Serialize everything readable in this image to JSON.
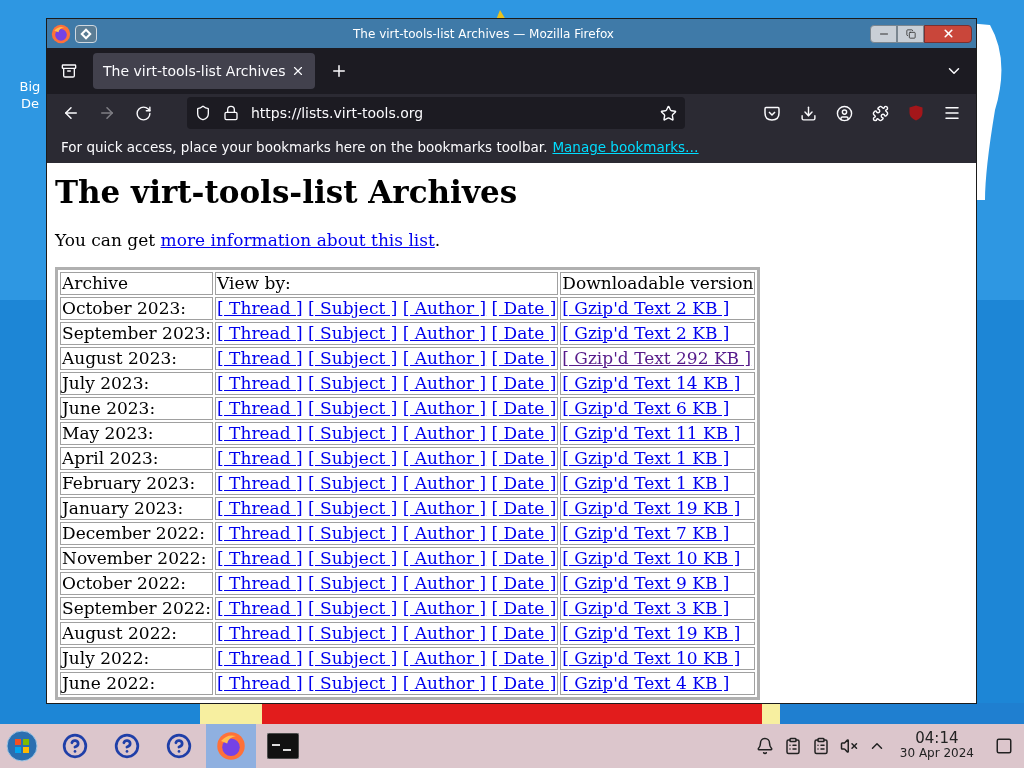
{
  "desktop": {
    "icon_label": [
      "Big",
      "De"
    ]
  },
  "window": {
    "title": "The virt-tools-list Archives — Mozilla Firefox"
  },
  "tabs": [
    {
      "label": "The virt-tools-list Archives",
      "selected": true
    }
  ],
  "url": "https://lists.virt-tools.org",
  "bookmarks_bar": {
    "message": "For quick access, place your bookmarks here on the bookmarks toolbar.",
    "link": "Manage bookmarks…"
  },
  "page": {
    "heading": "The virt-tools-list Archives",
    "intro_before": "You can get ",
    "intro_link": "more information about this list",
    "intro_after": "."
  },
  "table": {
    "columns": [
      "Archive",
      "View by:",
      "Downloadable version"
    ],
    "rows": [
      {
        "archive": "October 2023:",
        "views": [
          "[ Thread ]",
          "[ Subject ]",
          "[ Author ]",
          "[ Date ]"
        ],
        "download": "[ Gzip'd Text 2 KB ]",
        "visited": false
      },
      {
        "archive": "September 2023:",
        "views": [
          "[ Thread ]",
          "[ Subject ]",
          "[ Author ]",
          "[ Date ]"
        ],
        "download": "[ Gzip'd Text 2 KB ]",
        "visited": false
      },
      {
        "archive": "August 2023:",
        "views": [
          "[ Thread ]",
          "[ Subject ]",
          "[ Author ]",
          "[ Date ]"
        ],
        "download": "[ Gzip'd Text 292 KB ]",
        "visited": true
      },
      {
        "archive": "July 2023:",
        "views": [
          "[ Thread ]",
          "[ Subject ]",
          "[ Author ]",
          "[ Date ]"
        ],
        "download": "[ Gzip'd Text 14 KB ]",
        "visited": false
      },
      {
        "archive": "June 2023:",
        "views": [
          "[ Thread ]",
          "[ Subject ]",
          "[ Author ]",
          "[ Date ]"
        ],
        "download": "[ Gzip'd Text 6 KB ]",
        "visited": false
      },
      {
        "archive": "May 2023:",
        "views": [
          "[ Thread ]",
          "[ Subject ]",
          "[ Author ]",
          "[ Date ]"
        ],
        "download": "[ Gzip'd Text 11 KB ]",
        "visited": false
      },
      {
        "archive": "April 2023:",
        "views": [
          "[ Thread ]",
          "[ Subject ]",
          "[ Author ]",
          "[ Date ]"
        ],
        "download": "[ Gzip'd Text 1 KB ]",
        "visited": false
      },
      {
        "archive": "February 2023:",
        "views": [
          "[ Thread ]",
          "[ Subject ]",
          "[ Author ]",
          "[ Date ]"
        ],
        "download": "[ Gzip'd Text 1 KB ]",
        "visited": false
      },
      {
        "archive": "January 2023:",
        "views": [
          "[ Thread ]",
          "[ Subject ]",
          "[ Author ]",
          "[ Date ]"
        ],
        "download": "[ Gzip'd Text 19 KB ]",
        "visited": false
      },
      {
        "archive": "December 2022:",
        "views": [
          "[ Thread ]",
          "[ Subject ]",
          "[ Author ]",
          "[ Date ]"
        ],
        "download": "[ Gzip'd Text 7 KB ]",
        "visited": false
      },
      {
        "archive": "November 2022:",
        "views": [
          "[ Thread ]",
          "[ Subject ]",
          "[ Author ]",
          "[ Date ]"
        ],
        "download": "[ Gzip'd Text 10 KB ]",
        "visited": false
      },
      {
        "archive": "October 2022:",
        "views": [
          "[ Thread ]",
          "[ Subject ]",
          "[ Author ]",
          "[ Date ]"
        ],
        "download": "[ Gzip'd Text 9 KB ]",
        "visited": false
      },
      {
        "archive": "September 2022:",
        "views": [
          "[ Thread ]",
          "[ Subject ]",
          "[ Author ]",
          "[ Date ]"
        ],
        "download": "[ Gzip'd Text 3 KB ]",
        "visited": false
      },
      {
        "archive": "August 2022:",
        "views": [
          "[ Thread ]",
          "[ Subject ]",
          "[ Author ]",
          "[ Date ]"
        ],
        "download": "[ Gzip'd Text 19 KB ]",
        "visited": false
      },
      {
        "archive": "July 2022:",
        "views": [
          "[ Thread ]",
          "[ Subject ]",
          "[ Author ]",
          "[ Date ]"
        ],
        "download": "[ Gzip'd Text 10 KB ]",
        "visited": false
      },
      {
        "archive": "June 2022:",
        "views": [
          "[ Thread ]",
          "[ Subject ]",
          "[ Author ]",
          "[ Date ]"
        ],
        "download": "[ Gzip'd Text 4 KB ]",
        "visited": false
      }
    ]
  },
  "taskbar": {
    "apps": [
      {
        "kind": "help",
        "selected": false
      },
      {
        "kind": "help",
        "selected": false
      },
      {
        "kind": "help",
        "selected": false
      },
      {
        "kind": "browser",
        "selected": true
      },
      {
        "kind": "terminal",
        "selected": false
      }
    ],
    "clock": {
      "time": "04:14",
      "date": "30 Apr 2024"
    }
  }
}
